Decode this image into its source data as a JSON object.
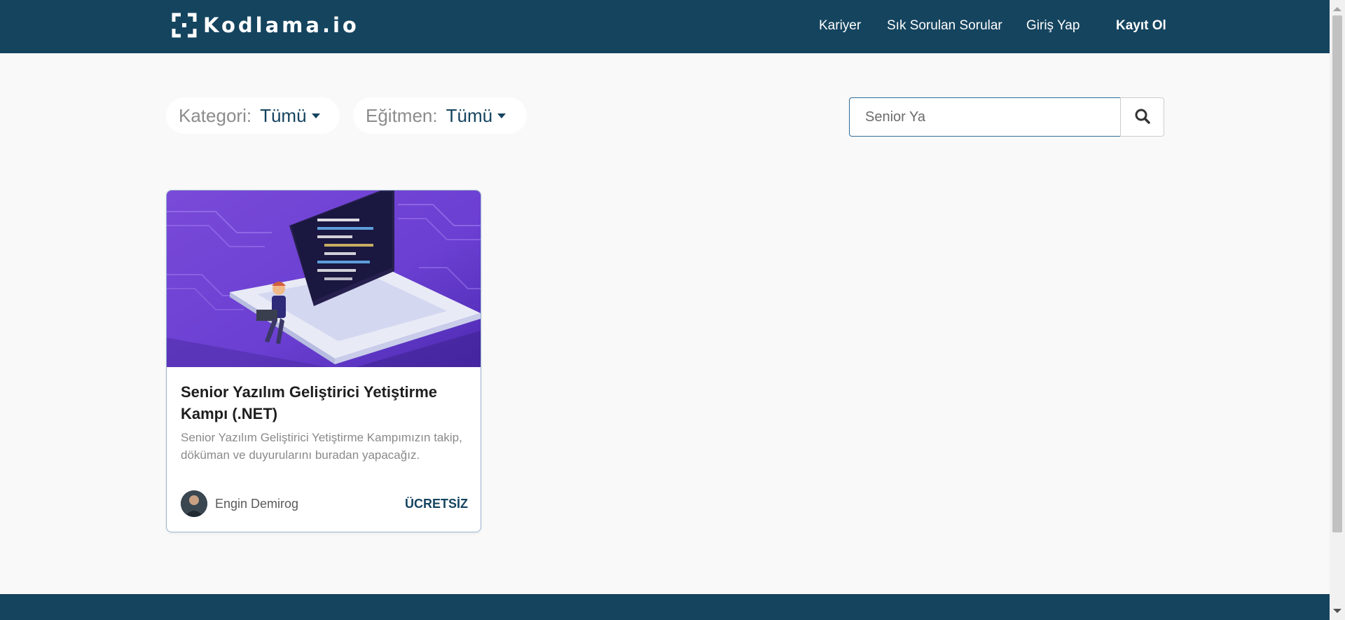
{
  "header": {
    "logo_text": "Kodlama.io",
    "nav": [
      {
        "label": "Kariyer"
      },
      {
        "label": "Sık Sorulan Sorular"
      },
      {
        "label": "Giriş Yap"
      },
      {
        "label": "Kayıt Ol"
      }
    ]
  },
  "filters": {
    "category": {
      "label": "Kategori:",
      "value": "Tümü"
    },
    "instructor": {
      "label": "Eğitmen:",
      "value": "Tümü"
    }
  },
  "search": {
    "value": "Senior Ya",
    "button_icon": "search-icon"
  },
  "courses": [
    {
      "title": "Senior Yazılım Geliştirici Yetiştirme Kampı (.NET)",
      "description": "Senior Yazılım Geliştirici Yetiştirme Kampımızın takip, döküman ve duyurularını buradan yapacağız.",
      "instructor": "Engin Demirog",
      "price": "ÜCRETSİZ"
    }
  ],
  "colors": {
    "brand": "#15445f",
    "background": "#f9f9f9",
    "card_image_purple": "#6b3fd0"
  }
}
